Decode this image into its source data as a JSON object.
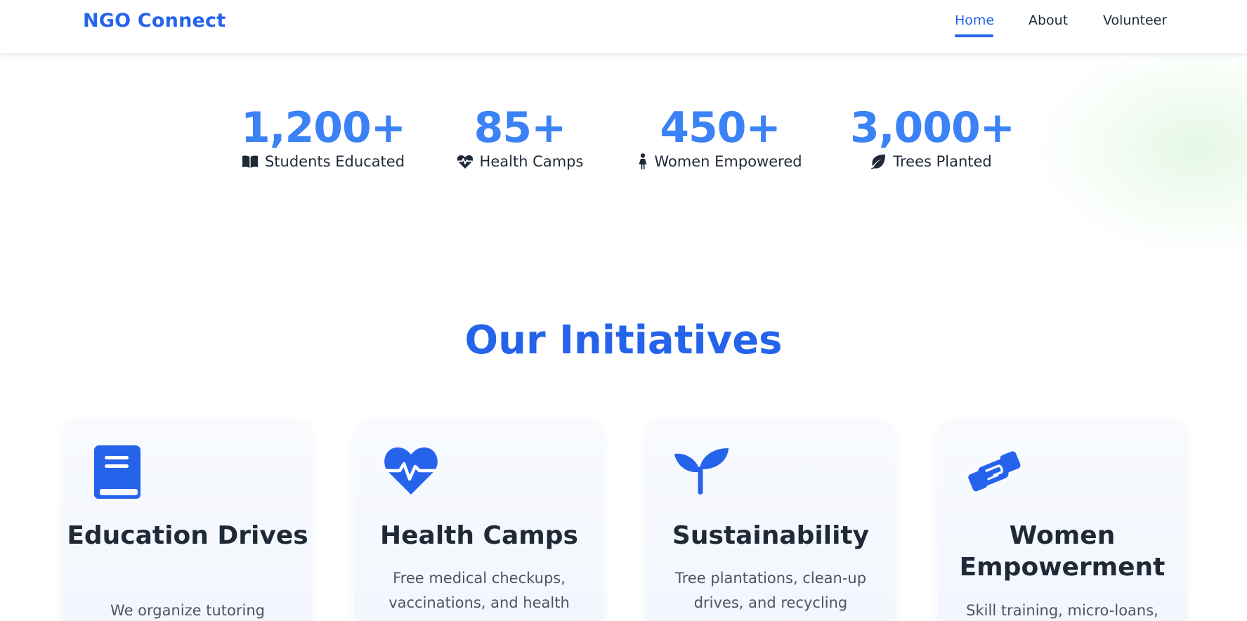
{
  "header": {
    "brand": "NGO Connect",
    "nav": [
      {
        "label": "Home",
        "active": true
      },
      {
        "label": "About",
        "active": false
      },
      {
        "label": "Volunteer",
        "active": false
      }
    ]
  },
  "stats": [
    {
      "value": "1,200+",
      "label": "Students Educated",
      "icon": "book-open-icon"
    },
    {
      "value": "85+",
      "label": "Health Camps",
      "icon": "heartbeat-icon"
    },
    {
      "value": "450+",
      "label": "Women Empowered",
      "icon": "female-person-icon"
    },
    {
      "value": "3,000+",
      "label": "Trees Planted",
      "icon": "leaf-icon"
    }
  ],
  "initiatives": {
    "title": "Our Initiatives",
    "cards": [
      {
        "title": "Education Drives",
        "desc": "We organize tutoring",
        "icon": "book-icon"
      },
      {
        "title": "Health Camps",
        "desc": "Free medical checkups, vaccinations, and health",
        "icon": "heart-pulse-icon"
      },
      {
        "title": "Sustainability",
        "desc": "Tree plantations, clean-up drives, and recycling",
        "icon": "seedling-icon"
      },
      {
        "title": "Women Empowerment",
        "desc": "Skill training, micro-loans,",
        "icon": "handshake-icon"
      }
    ]
  },
  "colors": {
    "accent": "#2563eb",
    "stat_number": "#3b82f6",
    "text": "#1f2937",
    "muted": "#4b5563"
  }
}
